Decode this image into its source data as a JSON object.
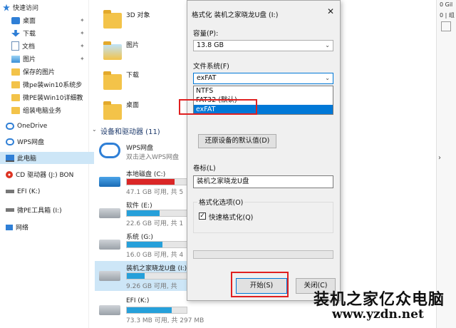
{
  "nav": {
    "items": [
      {
        "label": "快速访问",
        "icon": "star-icon",
        "pinned": false
      },
      {
        "label": "桌面",
        "icon": "desktop-icon",
        "pinned": true
      },
      {
        "label": "下载",
        "icon": "download-icon",
        "pinned": true
      },
      {
        "label": "文档",
        "icon": "document-icon",
        "pinned": true
      },
      {
        "label": "图片",
        "icon": "picture-icon",
        "pinned": true
      },
      {
        "label": "保存的图片",
        "icon": "folder-icon",
        "pinned": false
      },
      {
        "label": "微pe装win10系统步",
        "icon": "folder-icon",
        "pinned": false
      },
      {
        "label": "微PE装Win10详细教",
        "icon": "folder-icon",
        "pinned": false
      },
      {
        "label": "组装电脑业务",
        "icon": "folder-icon",
        "pinned": false
      },
      {
        "label": "OneDrive",
        "icon": "cloud-icon",
        "pinned": false
      },
      {
        "label": "WPS网盘",
        "icon": "cloud-icon",
        "pinned": false
      },
      {
        "label": "此电脑",
        "icon": "computer-icon",
        "pinned": false
      },
      {
        "label": "CD 驱动器 (J:) BON",
        "icon": "disc-icon",
        "pinned": false
      },
      {
        "label": "EFI (K:)",
        "icon": "drive-icon",
        "pinned": false
      },
      {
        "label": "微PE工具箱 (I:)",
        "icon": "drive-icon",
        "pinned": false
      },
      {
        "label": "网络",
        "icon": "network-icon",
        "pinned": false
      }
    ],
    "pin_glyph": "✦"
  },
  "main": {
    "folders": [
      {
        "label": "3D 对象"
      },
      {
        "label": "图片"
      },
      {
        "label": "下载"
      },
      {
        "label": "桌面"
      }
    ],
    "section_header": "设备和驱动器 (11)",
    "wps": {
      "name": "WPS网盘",
      "sub": "双击进入WPS网盘"
    },
    "drives": [
      {
        "name": "本地磁盘 (C:)",
        "free": "47.1 GB 可用, 共 5",
        "fill": 0.8,
        "warn": true
      },
      {
        "name": "软件 (E:)",
        "free": "22.6 GB 可用, 共 1",
        "fill": 0.55,
        "warn": false
      },
      {
        "name": "系统 (G:)",
        "free": "16.0 GB 可用, 共 4",
        "fill": 0.6,
        "warn": false
      },
      {
        "name": "装机之家晓龙U盘 (I:)",
        "free": "9.26 GB 可用, 共",
        "fill": 0.3,
        "warn": false
      },
      {
        "name": "EFI (K:)",
        "free": "73.3 MB 可用, 共 297 MB",
        "fill": 0.75,
        "warn": false
      }
    ]
  },
  "dialog": {
    "title": "格式化 装机之家晓龙U盘 (I:)",
    "close_glyph": "✕",
    "capacity_label": "容量(P):",
    "capacity_value": "13.8 GB",
    "fs_label": "文件系统(F)",
    "fs_value": "exFAT",
    "fs_options": [
      "NTFS",
      "FAT32 (默认)",
      "exFAT"
    ],
    "fs_selected_index": 2,
    "restore_button": "还原设备的默认值(D)",
    "volume_label": "卷标(L)",
    "volume_value": "装机之家晓龙U盘",
    "options_label": "格式化选项(O)",
    "quick_format_label": "快速格式化(Q)",
    "quick_format_checked": true,
    "start_button": "开始(S)",
    "close_button": "关闭(C)",
    "arrow_glyph": "⌄",
    "check_glyph": "✓"
  },
  "right_pane": {
    "top_text": "0 Gil",
    "sub_text": "0 | 组"
  },
  "watermark": {
    "line1": "装机之家亿众电脑",
    "line2": "www.yzdn.net"
  },
  "colors": {
    "highlight": "#e02020",
    "selection": "#0078d7",
    "bar_fill": "#26a0da"
  }
}
